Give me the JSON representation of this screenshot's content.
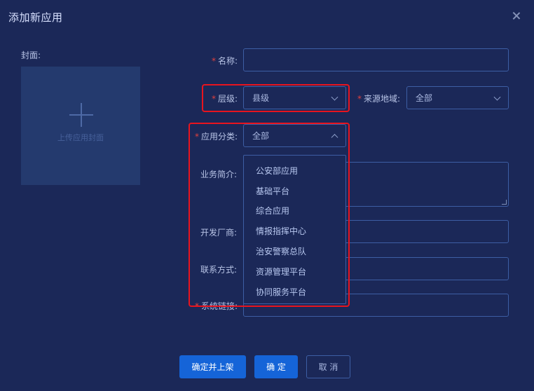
{
  "dialog": {
    "title": "添加新应用"
  },
  "cover": {
    "label": "封面:",
    "hint": "上传应用封面"
  },
  "form": {
    "name": {
      "label": "名称:",
      "value": ""
    },
    "level": {
      "label": "层级:",
      "value": "县级"
    },
    "source_region": {
      "label": "来源地域:",
      "value": "全部"
    },
    "category": {
      "label": "应用分类:",
      "value": "全部"
    },
    "business_intro": {
      "label": "业务简介:",
      "value": ""
    },
    "developer": {
      "label": "开发厂商:",
      "value": ""
    },
    "contact": {
      "label": "联系方式:",
      "value": ""
    },
    "system_link": {
      "label": "系统链接:",
      "value": ""
    }
  },
  "category_dropdown": {
    "options": [
      "公安部应用",
      "基础平台",
      "综合应用",
      "情报指挥中心",
      "治安警察总队",
      "资源管理平台",
      "协同服务平台"
    ]
  },
  "buttons": {
    "confirm_publish": "确定并上架",
    "confirm": "确 定",
    "cancel": "取 消"
  },
  "colors": {
    "background": "#1b2858",
    "accent": "#1564d8",
    "required": "#e0413c",
    "highlight": "#e8141e"
  }
}
